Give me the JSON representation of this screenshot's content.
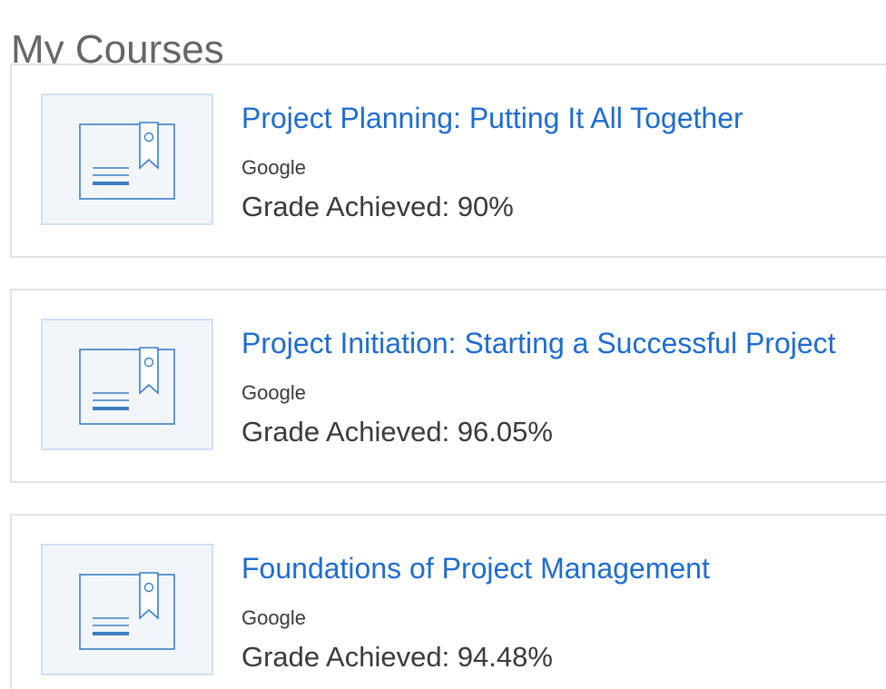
{
  "page": {
    "title": "My Courses"
  },
  "courses": [
    {
      "title": "Project Planning: Putting It All Together",
      "org": "Google",
      "grade": "Grade Achieved: 90%",
      "icon": "certificate-icon"
    },
    {
      "title": "Project Initiation: Starting a Successful Project",
      "org": "Google",
      "grade": "Grade Achieved: 96.05%",
      "icon": "certificate-icon"
    },
    {
      "title": "Foundations of Project Management",
      "org": "Google",
      "grade": "Grade Achieved: 94.48%",
      "icon": "certificate-icon"
    }
  ],
  "colors": {
    "link": "#1f6ccf",
    "icon_stroke": "#3d7fc1",
    "thumb_bg": "#f2f6fb",
    "thumb_border": "#cfe0f3",
    "card_border": "#e2e2e2"
  }
}
